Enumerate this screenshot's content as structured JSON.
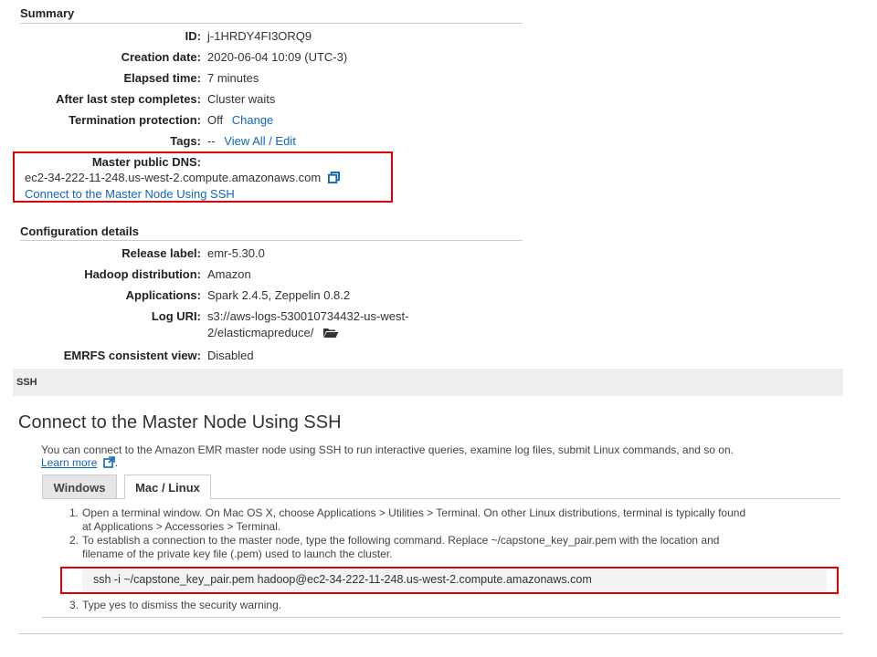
{
  "summary": {
    "title": "Summary",
    "rows": [
      {
        "label": "ID:",
        "value": "j-1HRDY4FI3ORQ9"
      },
      {
        "label": "Creation date:",
        "value": "2020-06-04 10:09 (UTC-3)"
      },
      {
        "label": "Elapsed time:",
        "value": "7 minutes"
      },
      {
        "label": "After last step completes:",
        "value": "Cluster waits"
      },
      {
        "label": "Termination protection:",
        "value": "Off",
        "link": "Change"
      },
      {
        "label": "Tags:",
        "value": "--",
        "link": "View All / Edit"
      }
    ],
    "master_dns_label": "Master public DNS:",
    "master_dns_value": "ec2-34-222-11-248.us-west-2.compute.amazonaws.com",
    "connect_link": "Connect to the Master Node Using SSH"
  },
  "config": {
    "title": "Configuration details",
    "rows": [
      {
        "label": "Release label:",
        "value": "emr-5.30.0"
      },
      {
        "label": "Hadoop distribution:",
        "value": "Amazon"
      },
      {
        "label": "Applications:",
        "value": "Spark 2.4.5, Zeppelin 0.8.2"
      },
      {
        "label": "Log URI:",
        "value_line1": "s3://aws-logs-530010734432-us-west-",
        "value_line2": "2/elasticmapreduce/"
      },
      {
        "label": "EMRFS consistent view:",
        "value": "Disabled"
      }
    ]
  },
  "ssh_bar": "SSH",
  "ssh": {
    "heading": "Connect to the Master Node Using SSH",
    "intro": "You can connect to the Amazon EMR master node using SSH to run interactive queries, examine log files, submit Linux commands, and so on.",
    "learn_more": "Learn more",
    "tabs": [
      "Windows",
      "Mac / Linux"
    ],
    "steps": {
      "s1_num": "1.",
      "s1_line1": "Open a terminal window. On Mac OS X, choose Applications > Utilities > Terminal. On other Linux distributions, terminal is typically found",
      "s1_line2": "at Applications > Accessories > Terminal.",
      "s2_num": "2.",
      "s2_line1": "To establish a connection to the master node, type the following command. Replace ~/capstone_key_pair.pem with the location and",
      "s2_line2": "filename of the private key file (.pem) used to launch the cluster.",
      "command": "ssh -i ~/capstone_key_pair.pem hadoop@ec2-34-222-11-248.us-west-2.compute.amazonaws.com",
      "s3_num": "3.",
      "s3_line": "Type yes to dismiss the security warning."
    }
  },
  "colors": {
    "link": "#1166bb",
    "highlight": "#dd0000"
  },
  "icons": {
    "copy": "copy-icon",
    "folder": "folder-icon",
    "external": "external-link-icon"
  }
}
